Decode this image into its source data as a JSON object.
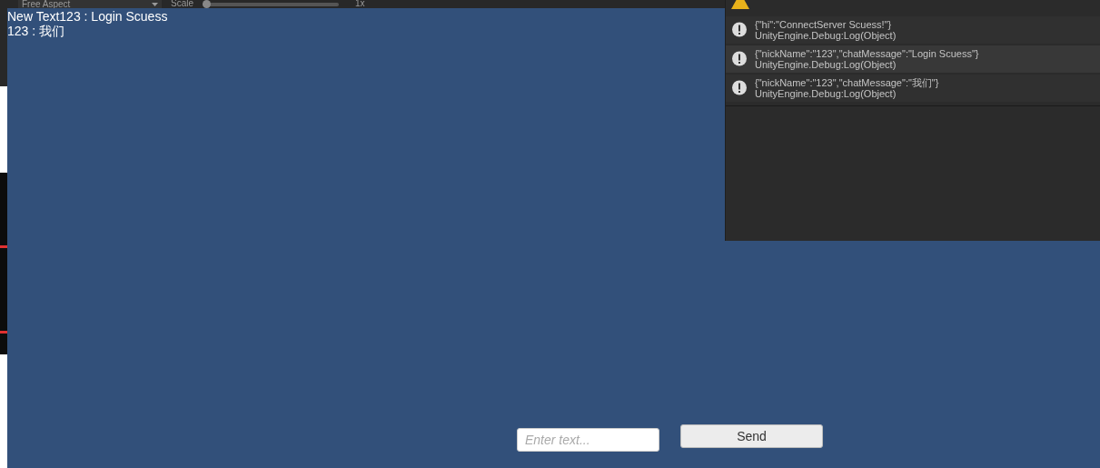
{
  "toolbar": {
    "aspect": "Free Aspect",
    "scale_label": "Scale",
    "scale": {
      "level": 0.0
    },
    "scale_value": "1x"
  },
  "game_view": {
    "chat_lines": [
      "New Text123 : Login Scuess",
      "123 : 我们"
    ],
    "input": {
      "placeholder": "Enter text..."
    },
    "send_button": "Send"
  },
  "console": {
    "entries": [
      {
        "kind": "warning"
      },
      {
        "kind": "info",
        "message": "{\"hi\":\"ConnectServer Scuess!\"}",
        "trace": "UnityEngine.Debug:Log(Object)"
      },
      {
        "kind": "info",
        "message": "{\"nickName\":\"123\",\"chatMessage\":\"Login Scuess\"}",
        "trace": "UnityEngine.Debug:Log(Object)"
      },
      {
        "kind": "info",
        "message": "{\"nickName\":\"123\",\"chatMessage\":\"我们\"}",
        "trace": "UnityEngine.Debug:Log(Object)"
      }
    ]
  }
}
